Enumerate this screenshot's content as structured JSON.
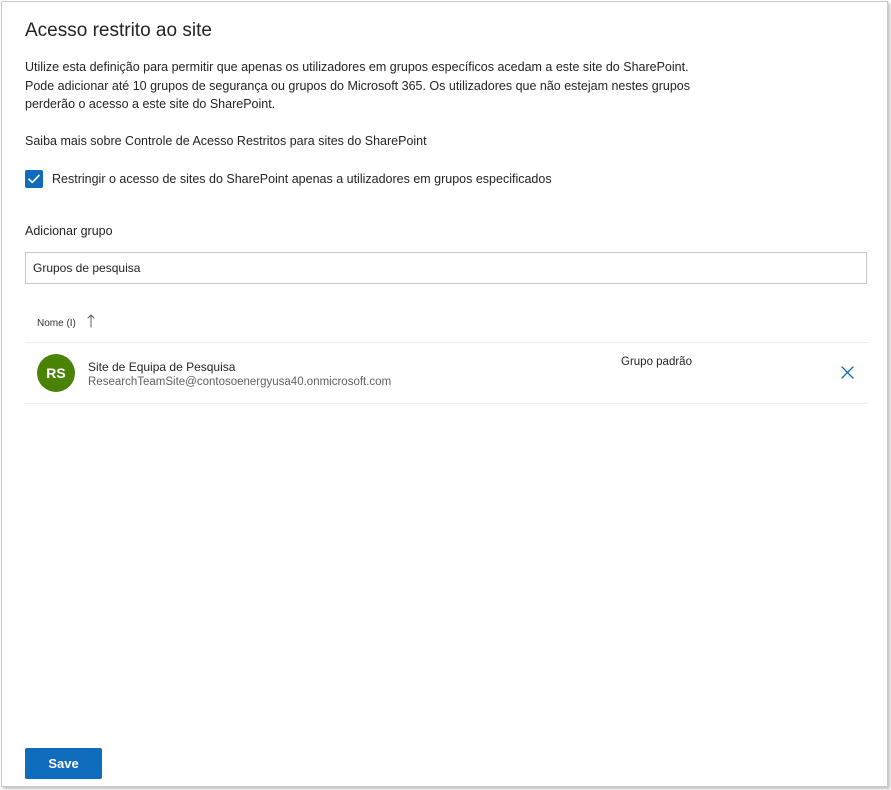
{
  "panel": {
    "title": "Acesso restrito ao site",
    "description_lines": [
      "Utilize esta definição para permitir que apenas os utilizadores em grupos específicos acedam a este site do SharePoint.",
      "Pode adicionar até 10 grupos de segurança ou grupos do Microsoft 365. Os utilizadores que não estejam nestes grupos",
      "perderão o acesso a este site do SharePoint."
    ],
    "learn_more_link": "Saiba mais sobre Controle de Acesso Restritos para sites do SharePoint",
    "restrict_checkbox": {
      "label": "Restringir o acesso de sites do SharePoint apenas a utilizadores em grupos especificados",
      "checked": true
    },
    "add_group": {
      "label": "Adicionar grupo",
      "input_value": "Grupos de pesquisa"
    },
    "table": {
      "header_name": "Nome (I)",
      "sort_icon": "arrow-up-icon",
      "rows": [
        {
          "initials": "RS",
          "avatar_color": "#498205",
          "name": "Site de Equipa de Pesquisa",
          "email": "ResearchTeamSite@contosoenergyusa40.onmicrosoft.com",
          "group_type": "Grupo padrão",
          "remove_icon": "close-icon"
        }
      ]
    },
    "save_label": "Save"
  },
  "colors": {
    "accent": "#0f6cbd",
    "avatar": "#498205"
  }
}
